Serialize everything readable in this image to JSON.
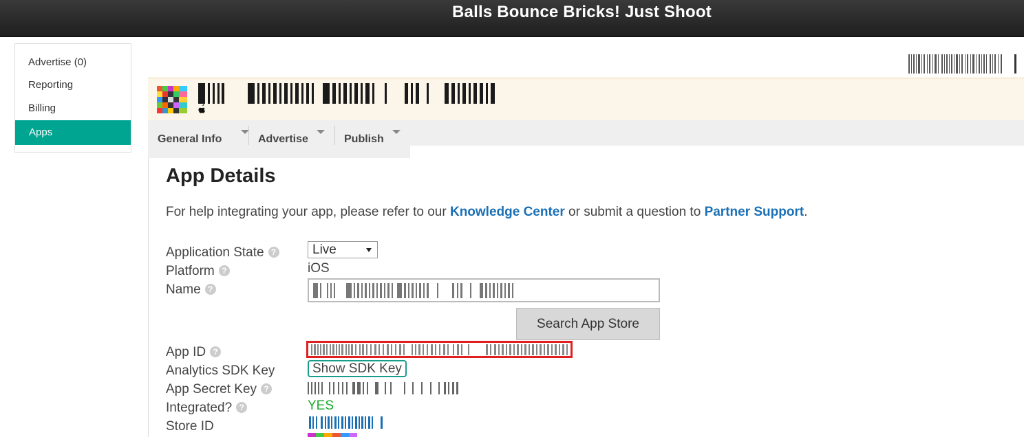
{
  "header": {
    "title": "Balls Bounce Bricks!  Just Shoot"
  },
  "sidebar": {
    "items": [
      {
        "label": "Advertise (0)",
        "active": false
      },
      {
        "label": "Reporting",
        "active": false
      },
      {
        "label": "Billing",
        "active": false
      },
      {
        "label": "Apps",
        "active": true
      }
    ]
  },
  "tabs": [
    {
      "label": "General Info"
    },
    {
      "label": "Advertise"
    },
    {
      "label": "Publish"
    }
  ],
  "page": {
    "title": "App Details",
    "help_prefix": "For help integrating your app, please refer to our ",
    "help_link1": "Knowledge Center",
    "help_middle": " or submit a question to ",
    "help_link2": "Partner Support",
    "help_suffix": "."
  },
  "form": {
    "labels": {
      "application_state": "Application State",
      "platform": "Platform",
      "name": "Name",
      "app_id": "App ID",
      "analytics_sdk_key": "Analytics SDK Key",
      "app_secret_key": "App Secret Key",
      "integrated": "Integrated?",
      "store_id": "Store ID"
    },
    "help_icon": "?",
    "application_state_value": "Live",
    "platform_value": "iOS",
    "search_button": "Search App Store",
    "show_sdk_key": "Show SDK Key",
    "integrated_value": "YES"
  },
  "colors": {
    "accent": "#00a591",
    "link": "#1a6fb5",
    "highlight_red": "#e02020",
    "yes_green": "#1aaa2a"
  },
  "icons": [
    "question-mark-icon",
    "apple-icon",
    "caret-down-icon",
    "app-icon"
  ]
}
